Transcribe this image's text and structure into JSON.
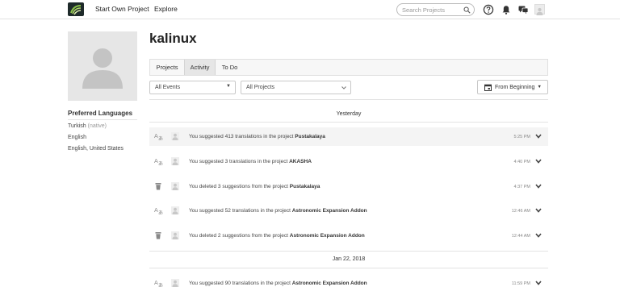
{
  "nav": {
    "start_project": "Start Own Project",
    "explore": "Explore",
    "search_placeholder": "Search Projects"
  },
  "profile": {
    "username": "kalinux",
    "preferred_languages_title": "Preferred Languages",
    "languages": [
      {
        "name": "Turkish",
        "note": "(native)"
      },
      {
        "name": "English",
        "note": ""
      },
      {
        "name": "English, United States",
        "note": ""
      }
    ]
  },
  "tabs": [
    {
      "label": "Projects",
      "active": false
    },
    {
      "label": "Activity",
      "active": true
    },
    {
      "label": "To Do",
      "active": false
    }
  ],
  "filters": {
    "events": "All Events",
    "projects": "All Projects",
    "range": "From Beginning"
  },
  "activity": {
    "groups": [
      {
        "date": "Yesterday",
        "items": [
          {
            "icon": "translate-icon",
            "text": "You suggested 413 translations in the project ",
            "project": "Pustakalaya",
            "time": "5:25 PM",
            "highlight": true
          },
          {
            "icon": "translate-icon",
            "text": "You suggested 3 translations in the project ",
            "project": "AKASHA",
            "time": "4:40 PM",
            "highlight": false
          },
          {
            "icon": "trash-icon",
            "text": "You deleted 3 suggestions from the project ",
            "project": "Pustakalaya",
            "time": "4:37 PM",
            "highlight": false
          },
          {
            "icon": "translate-icon",
            "text": "You suggested 52 translations in the project ",
            "project": "Astronomic Expansion Addon",
            "time": "12:46 AM",
            "highlight": false
          },
          {
            "icon": "trash-icon",
            "text": "You deleted 2 suggestions from the project ",
            "project": "Astronomic Expansion Addon",
            "time": "12:44 AM",
            "highlight": false
          }
        ]
      },
      {
        "date": "Jan 22, 2018",
        "items": [
          {
            "icon": "translate-icon",
            "text": "You suggested 90 translations in the project ",
            "project": "Astronomic Expansion Addon",
            "time": "11:59 PM",
            "highlight": false
          }
        ]
      }
    ]
  },
  "colors": {
    "accent_logo": "#8bc34a",
    "text": "#333333",
    "row_highlight": "#f4f4f4",
    "border": "#e0e0e0"
  }
}
